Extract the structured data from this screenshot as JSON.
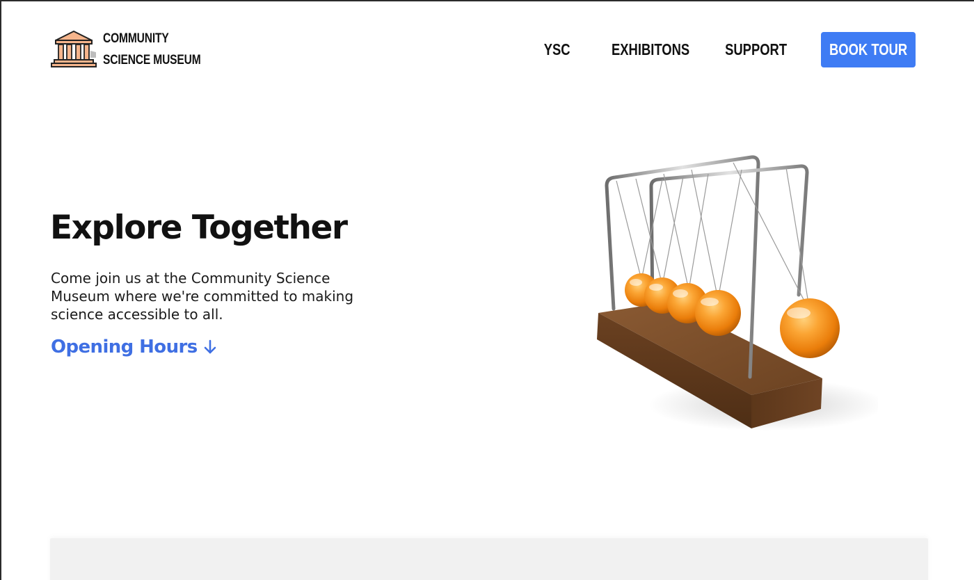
{
  "header": {
    "logo": {
      "icon": "museum-building-icon",
      "line1": "COMMUNITY",
      "line2": "SCIENCE MUSEUM"
    },
    "nav": [
      {
        "label": "YSC"
      },
      {
        "label": "EXHIBITONS"
      },
      {
        "label": "SUPPORT"
      }
    ],
    "cta_label": "BOOK TOUR"
  },
  "hero": {
    "title": "Explore Together",
    "body": "Come join us at the Community Science Museum where we're committed to making science accessible to all.",
    "link_label": "Opening Hours",
    "link_icon": "arrow-down-icon",
    "image": "newtons-cradle-illustration"
  },
  "colors": {
    "accent": "#3f7cf4",
    "link": "#3f6fe3",
    "text": "#111111",
    "ball": "#f08a10",
    "wood": "#6e4526"
  }
}
